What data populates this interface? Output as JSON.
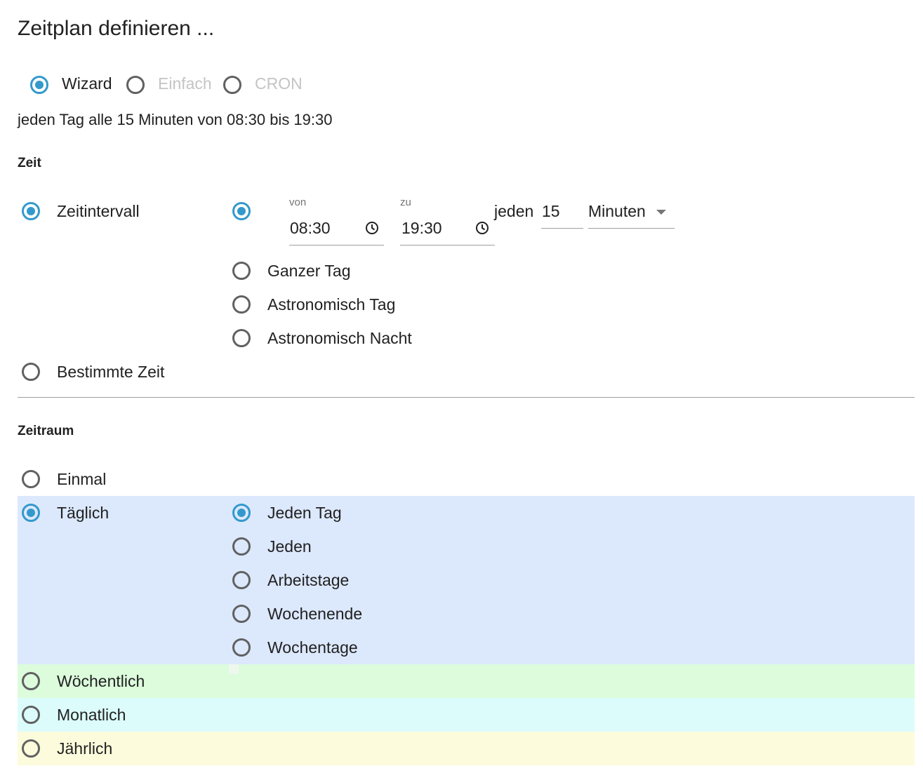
{
  "title": "Zeitplan definieren ...",
  "mode": {
    "options": [
      {
        "label": "Wizard",
        "selected": true,
        "disabled": false
      },
      {
        "label": "Einfach",
        "selected": false,
        "disabled": true
      },
      {
        "label": "CRON",
        "selected": false,
        "disabled": true
      }
    ]
  },
  "summary": "jeden Tag alle 15 Minuten von 08:30 bis 19:30",
  "zeit": {
    "heading": "Zeit",
    "interval_label": "Zeitintervall",
    "specific_label": "Bestimmte Zeit",
    "from_label": "von",
    "from_value": "08:30",
    "to_label": "zu",
    "to_value": "19:30",
    "every_label": "jeden",
    "every_value": "15",
    "unit": "Minuten",
    "options": [
      "Ganzer Tag",
      "Astronomisch Tag",
      "Astronomisch Nacht"
    ]
  },
  "zeitraum": {
    "heading": "Zeitraum",
    "once": "Einmal",
    "daily": "Täglich",
    "daily_options": [
      "Jeden Tag",
      "Jeden",
      "Arbeitstage",
      "Wochenende",
      "Wochentage"
    ],
    "weekly": "Wöchentlich",
    "monthly": "Monatlich",
    "yearly": "Jährlich"
  },
  "colors": {
    "accent": "#3399cc",
    "daily_band": "#dce8fc",
    "weekly_band": "#dcfcdc",
    "monthly_band": "#dcfcfc",
    "yearly_band": "#fcfcdc"
  }
}
